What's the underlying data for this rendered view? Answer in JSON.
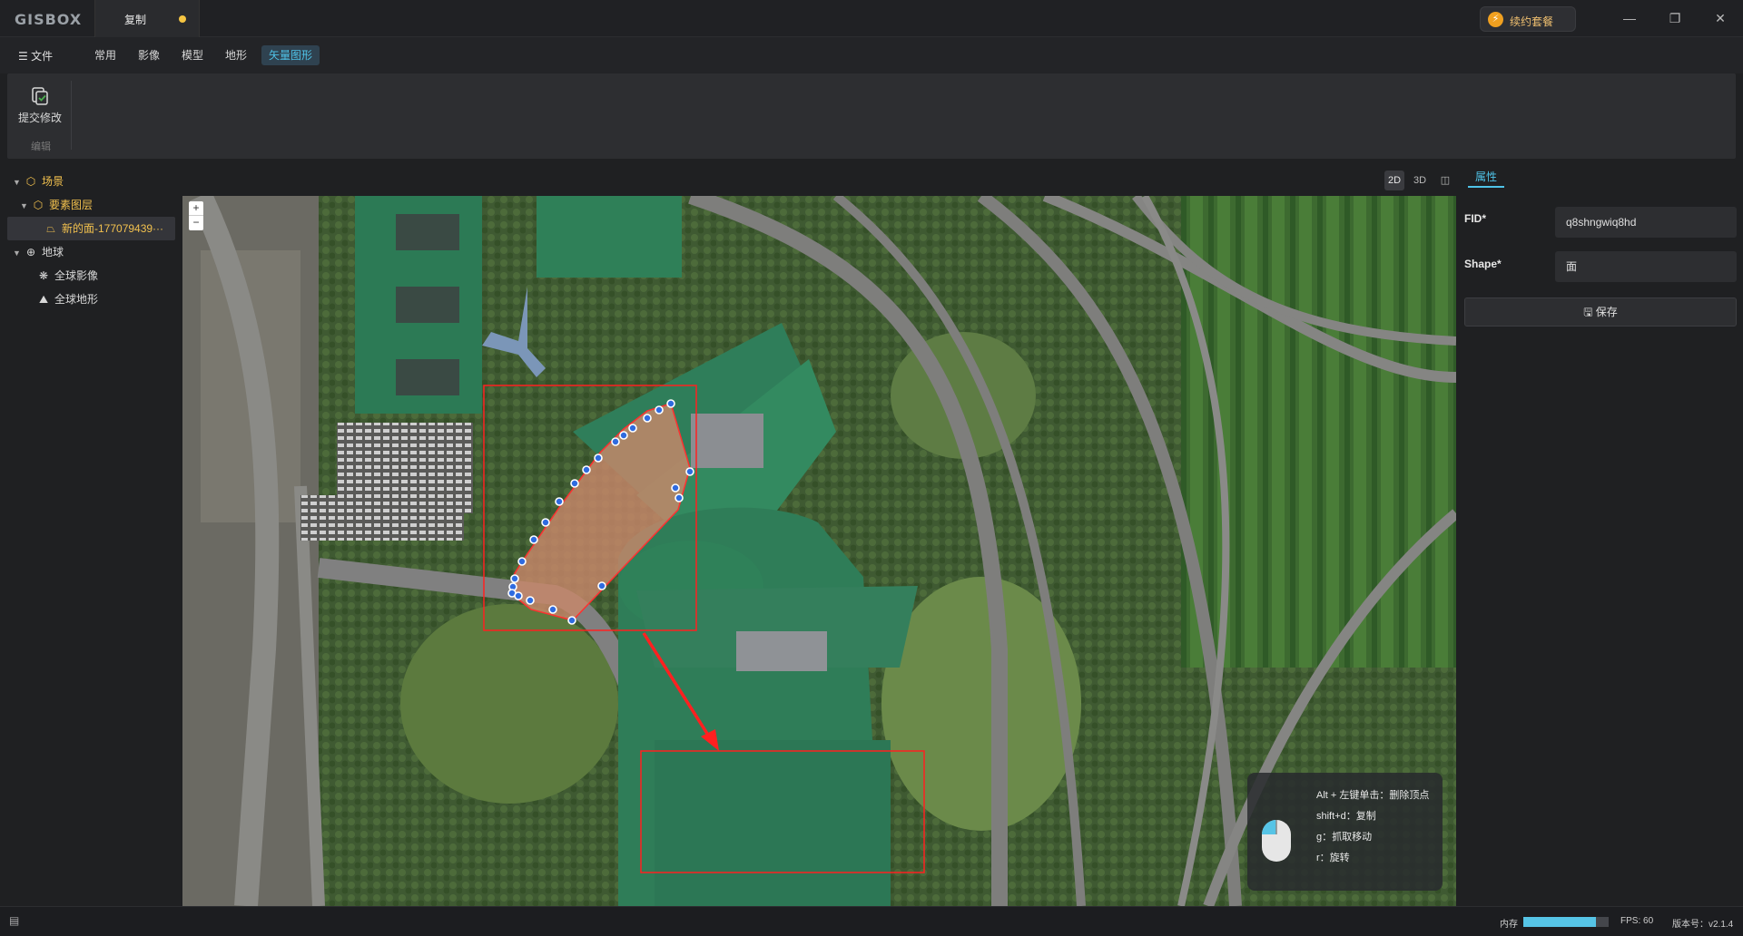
{
  "title_bar": {
    "logo": "GISBOX",
    "tab_label": "复制",
    "upgrade_label": "续约套餐",
    "win_min": "—",
    "win_max": "❐",
    "win_close": "✕"
  },
  "menu": {
    "file_label": "文件",
    "items": [
      "常用",
      "影像",
      "模型",
      "地形",
      "矢量图形"
    ],
    "active_index": 4
  },
  "ribbon": {
    "submit_label": "提交修改",
    "group_label": "编辑"
  },
  "tree": {
    "scene_label": "场景",
    "feature_layer_label": "要素图层",
    "feature_item_label": "新的面-177079439···",
    "globe_label": "地球",
    "imagery_label": "全球影像",
    "terrain_label": "全球地形"
  },
  "view_modes": [
    "2D",
    "3D",
    "◫"
  ],
  "map": {
    "zoom_in": "+",
    "zoom_out": "−",
    "hints": [
      "Alt + 左键单击：删除顶点",
      "shift+d：复制",
      "g：抓取移动",
      "r：旋转"
    ]
  },
  "properties": {
    "tab_label": "属性",
    "fid_label": "FID*",
    "fid_value": "q8shngwiq8hd",
    "shape_label": "Shape*",
    "shape_value": "面",
    "save_label": "保存"
  },
  "status": {
    "memory_label": "内存",
    "memory_fraction": 0.85,
    "fps_label": "FPS: 60",
    "version_label": "版本号：v2.1.4"
  },
  "colors": {
    "accent": "#4fc3e8",
    "highlight": "#f2c14e",
    "polygon_fill": "#c8876a",
    "vertex": "#2f6be0",
    "annotation_red": "#ff2020"
  }
}
